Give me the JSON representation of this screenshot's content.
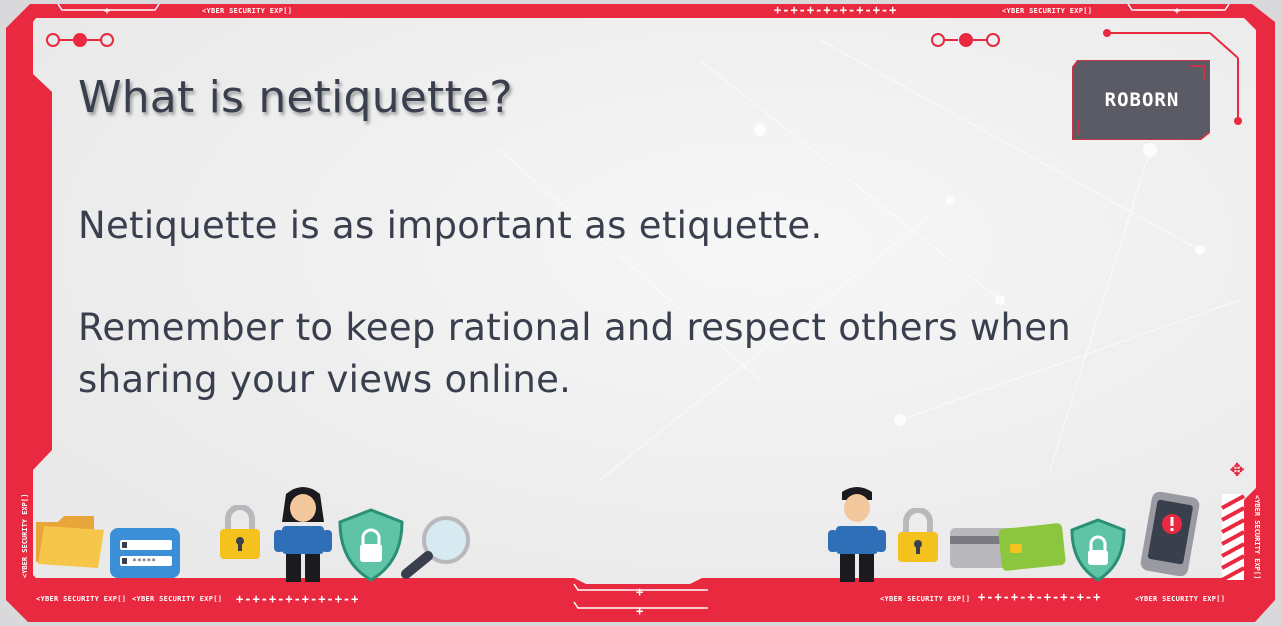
{
  "slide": {
    "title": "What is netiquette?",
    "paragraph1": "Netiquette is as important as etiquette.",
    "paragraph2": "Remember to keep rational and respect others when sharing your views online."
  },
  "frame": {
    "tag_label": "<YBER SECURITY EXP[]",
    "plus_chain": "+-+-+-+-+-+-+-+"
  },
  "logo": {
    "text": "ROBORN"
  },
  "colors": {
    "frame_red": "#e8293f",
    "text": "#3a3f4e",
    "background": "#efefef",
    "logo_bg": "#5b5b66"
  },
  "icons": [
    "folder-icon",
    "login-card-icon",
    "padlock-icon",
    "lego-woman-figure",
    "shield-lock-icon",
    "magnifier-icon",
    "lego-man-figure",
    "padlock-icon",
    "credit-cards-icon",
    "shield-lock-icon",
    "smartphone-alert-icon",
    "move-icon"
  ]
}
